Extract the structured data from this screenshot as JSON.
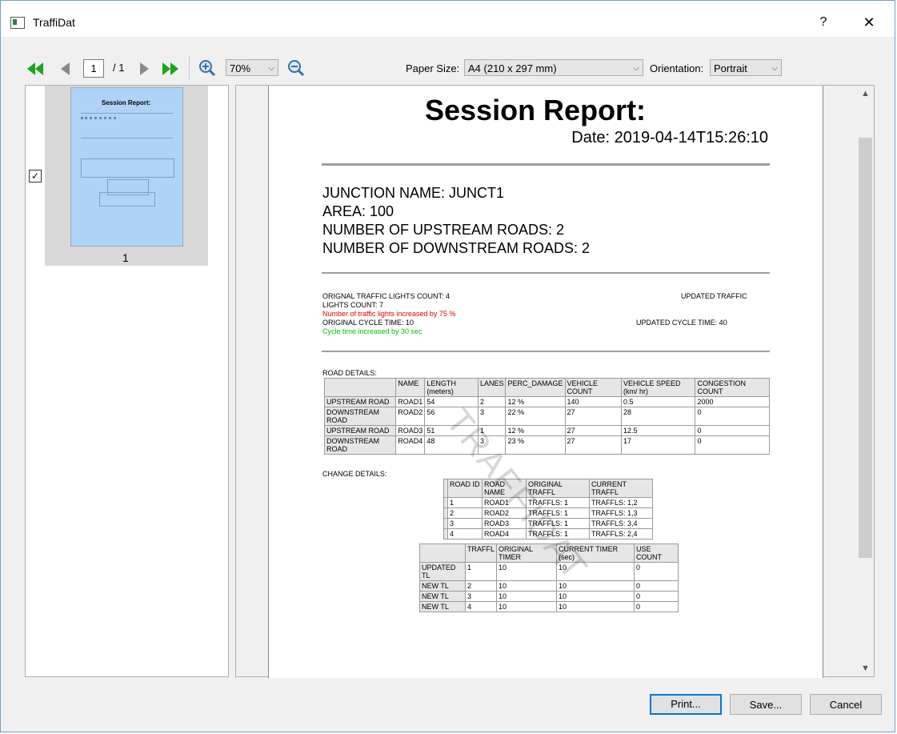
{
  "window": {
    "title": "TraffiDat",
    "help_label": "?",
    "close_label": "✕"
  },
  "toolbar": {
    "current_page": "1",
    "total_pages": "/ 1",
    "zoom": "70%",
    "paper_size_label": "Paper Size:",
    "paper_size_value": "A4 (210 x 297 mm)",
    "orientation_label": "Orientation:",
    "orientation_value": "Portrait"
  },
  "thumbnail": {
    "page_number": "1",
    "checked": true,
    "title": "Session Report:"
  },
  "report": {
    "title": "Session Report:",
    "date": "Date: 2019-04-14T15:26:10",
    "junction_name": "JUNCTION NAME: JUNCT1",
    "area": "AREA: 100",
    "upstream": "NUMBER OF UPSTREAM ROADS: 2",
    "downstream": "NUMBER OF DOWNSTREAM ROADS: 2",
    "orig_lights": "ORIGNAL TRAFFIC LIGHTS COUNT: 4",
    "lights_count": "LIGHTS COUNT: 7",
    "updated_traffic": "UPDATED TRAFFIC",
    "lights_increase": "Number of traffic lights increased by 75 %",
    "orig_cycle": "ORIGINAL CYCLE TIME: 10",
    "updated_cycle": "UPDATED CYCLE TIME: 40",
    "cycle_increase": "Cycle time increased by 30 sec",
    "road_details_label": "ROAD DETAILS:",
    "change_details_label": "CHANGE DETAILS:",
    "watermark": "TRAFFIDAT",
    "road_table": {
      "headers": [
        "",
        "NAME",
        "LENGTH (meters)",
        "LANES",
        "PERC_DAMAGE",
        "VEHICLE COUNT",
        "VEHICLE SPEED (km/ hr)",
        "CONGESTION COUNT"
      ],
      "rows": [
        [
          "UPSTREAM ROAD",
          "ROAD1",
          "54",
          "2",
          "12 %",
          "140",
          "0.5",
          "2000"
        ],
        [
          "DOWNSTREAM ROAD",
          "ROAD2",
          "56",
          "3",
          "22 %",
          "27",
          "28",
          "0"
        ],
        [
          "UPSTREAM ROAD",
          "ROAD3",
          "51",
          "1",
          "12 %",
          "27",
          "12.5",
          "0"
        ],
        [
          "DOWNSTREAM ROAD",
          "ROAD4",
          "48",
          "3",
          "23 %",
          "27",
          "17",
          "0"
        ]
      ]
    },
    "change_table": {
      "headers": [
        "",
        "ROAD ID",
        "ROAD NAME",
        "ORIGINAL TRAFFL",
        "CURRENT TRAFFL"
      ],
      "rows": [
        [
          "",
          "1",
          "ROAD1",
          "TRAFFLS: 1",
          "TRAFFLS: 1,2"
        ],
        [
          "",
          "2",
          "ROAD2",
          "TRAFFLS: 1",
          "TRAFFLS: 1,3"
        ],
        [
          "",
          "3",
          "ROAD3",
          "TRAFFLS: 1",
          "TRAFFLS: 3,4"
        ],
        [
          "",
          "4",
          "ROAD4",
          "TRAFFLS: 1",
          "TRAFFLS: 2,4"
        ]
      ]
    },
    "timer_table": {
      "headers": [
        "",
        "TRAFFL",
        "ORIGINAL TIMER",
        "CURRENT TIMER (sec)",
        "USE COUNT"
      ],
      "rows": [
        [
          "UPDATED TL",
          "1",
          "10",
          "10",
          "0"
        ],
        [
          "NEW TL",
          "2",
          "10",
          "10",
          "0"
        ],
        [
          "NEW TL",
          "3",
          "10",
          "10",
          "0"
        ],
        [
          "NEW TL",
          "4",
          "10",
          "10",
          "0"
        ]
      ]
    }
  },
  "buttons": {
    "print": "Print...",
    "save": "Save...",
    "cancel": "Cancel"
  },
  "colors": {
    "red_text": "#e00000",
    "green_text": "#00c000",
    "thumbnail_bg": "#aed3f7",
    "default_button_border": "#0078d7"
  }
}
